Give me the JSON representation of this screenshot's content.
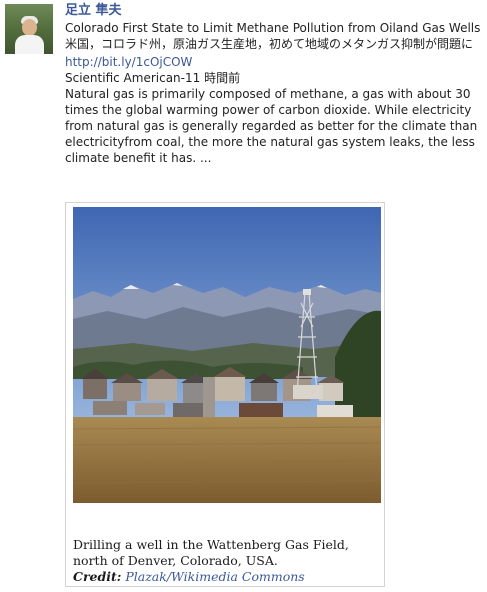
{
  "post": {
    "author": "足立 隼夫",
    "title_en": "Colorado First State to Limit Methane Pollution from Oiland Gas Wells",
    "title_ja": "米国，コロラド州，原油ガス生産地，初めて地域のメタンガス抑制が問題に",
    "link": "http://bit.ly/1cOjCOW",
    "source": "Scientific American-11 時間前",
    "summary": "Natural gas is primarily composed of methane, a gas with about 30 times the global warming power of carbon dioxide. While electricity from natural gas is generally regarded as better for the climate than electricityfrom coal, the more the natural gas system leaks, the less climate benefit it has. ..."
  },
  "figure": {
    "caption": "Drilling a well in the Wattenberg Gas Field, north of Denver, Colorado, USA.",
    "credit_label": "Credit:",
    "credit_value": "Plazak/Wikimedia Commons"
  },
  "icons": [
    "avatar"
  ],
  "colors": {
    "link": "#3b5998",
    "text": "#222222",
    "frame": "#d3d3d3"
  }
}
